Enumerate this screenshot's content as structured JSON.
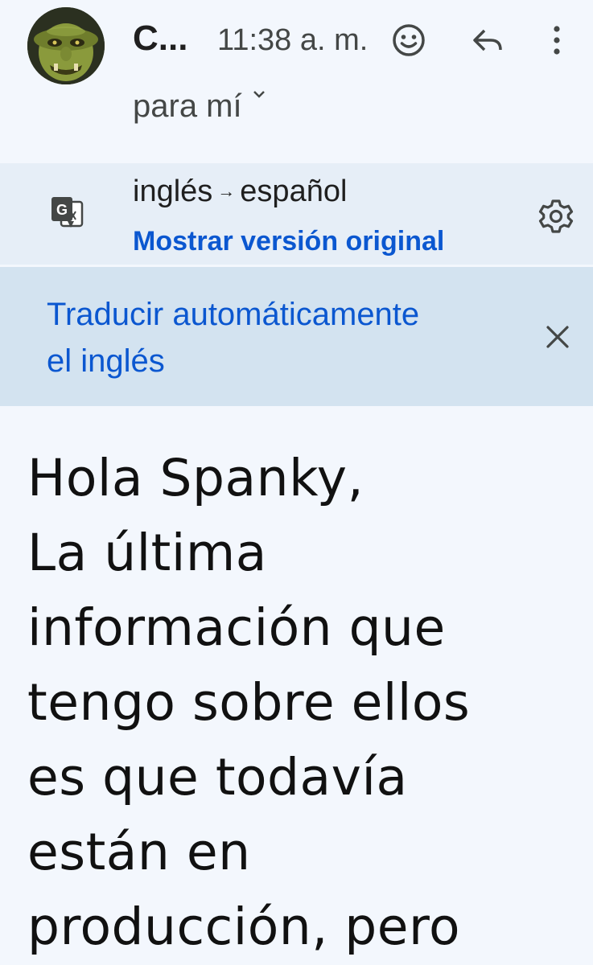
{
  "header": {
    "sender": "C...",
    "time": "11:38 a. m.",
    "recipient": "para mí"
  },
  "translation": {
    "from_lang": "inglés",
    "to_lang": "español",
    "show_original": "Mostrar versión original"
  },
  "auto_translate": {
    "line1": "Traducir automáticamente",
    "line2": "el inglés"
  },
  "body": {
    "lines": [
      "Hola Spanky,",
      "La última",
      "información que",
      "tengo sobre ellos",
      "es que todavía",
      "están en",
      "producción, pero"
    ]
  },
  "icons": {
    "emoji": "add-reaction-icon",
    "reply": "reply-icon",
    "more": "more-vert-icon",
    "translate": "google-translate-icon",
    "settings": "gear-icon",
    "close": "close-icon",
    "expand": "chevron-down-icon"
  },
  "colors": {
    "link_blue": "#0b57d0",
    "page_bg": "#f3f7fd",
    "translate_bar_bg": "#e6eef7",
    "banner_bg": "#d3e3f0"
  }
}
